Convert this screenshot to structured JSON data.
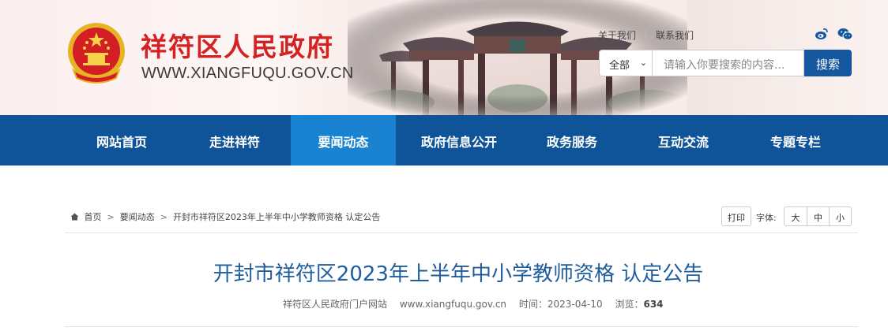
{
  "header": {
    "site_name": "祥符区人民政府",
    "site_url": "WWW.XIANGFUQU.GOV.CN",
    "top_links": [
      "关于我们",
      "联系我们"
    ],
    "social_icons": [
      "weibo-icon",
      "wechat-icon"
    ],
    "search": {
      "scope_selected": "全部",
      "placeholder": "请输入你要搜索的内容...",
      "button_label": "搜索"
    }
  },
  "nav": {
    "items": [
      {
        "label": "网站首页"
      },
      {
        "label": "走进祥符"
      },
      {
        "label": "要闻动态"
      },
      {
        "label": "政府信息公开"
      },
      {
        "label": "政务服务"
      },
      {
        "label": "互动交流"
      },
      {
        "label": "专题专栏"
      }
    ],
    "active_index": 2
  },
  "breadcrumb": {
    "items": [
      "首页",
      "要闻动态",
      "开封市祥符区2023年上半年中小学教师资格 认定公告"
    ]
  },
  "tools": {
    "print_label": "打印",
    "font_label": "字体:",
    "font_sizes": [
      "大",
      "中",
      "小"
    ]
  },
  "article": {
    "title": "开封市祥符区2023年上半年中小学教师资格 认定公告",
    "source": "祥符区人民政府门户网站",
    "url": "www.xiangfuqu.gov.cn",
    "time_label": "时间：",
    "time": "2023-04-10",
    "views_label": "浏览：",
    "views": "634"
  },
  "colors": {
    "brand_red": "#d42121",
    "nav_blue": "#0f5499",
    "nav_active": "#1a83d1",
    "title_blue": "#1f5d9e"
  }
}
